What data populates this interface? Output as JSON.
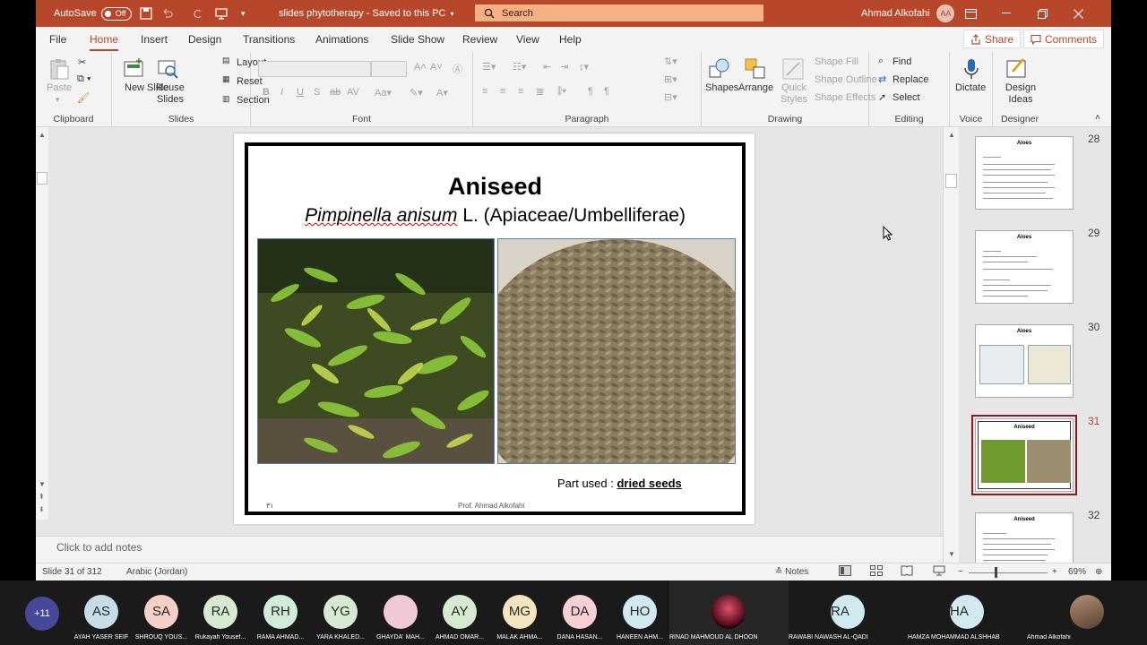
{
  "titlebar": {
    "autosave_label": "AutoSave",
    "autosave_state": "Off",
    "doc_title": "slides phytotherapy  -  Saved to this PC",
    "search_placeholder": "Search",
    "user_name": "Ahmad Alkofahi",
    "user_initials": "AA",
    "accent_color": "#b7472a"
  },
  "tabs": [
    "File",
    "Home",
    "Insert",
    "Design",
    "Transitions",
    "Animations",
    "Slide Show",
    "Review",
    "View",
    "Help"
  ],
  "active_tab": "Home",
  "share_label": "Share",
  "comments_label": "Comments",
  "ribbon": {
    "clipboard": {
      "label": "Clipboard",
      "paste": "Paste"
    },
    "slides": {
      "label": "Slides",
      "new_slide": "New Slide",
      "reuse_slides": "Reuse Slides",
      "layout": "Layout",
      "reset": "Reset",
      "section": "Section"
    },
    "font": {
      "label": "Font"
    },
    "paragraph": {
      "label": "Paragraph"
    },
    "drawing": {
      "label": "Drawing",
      "shapes": "Shapes",
      "arrange": "Arrange",
      "quick_styles": "Quick Styles",
      "shape_fill": "Shape Fill",
      "shape_outline": "Shape Outline",
      "shape_effects": "Shape Effects"
    },
    "editing": {
      "label": "Editing",
      "find": "Find",
      "replace": "Replace",
      "select": "Select"
    },
    "voice": {
      "label": "Voice",
      "dictate": "Dictate"
    },
    "designer": {
      "label": "Designer",
      "design_ideas": "Design Ideas"
    }
  },
  "slide": {
    "title": "Aniseed",
    "subtitle_italic": "Pimpinella anisum",
    "subtitle_rest": " L. (Apiaceae/Umbelliferae)",
    "part_used_label": "Part used : ",
    "part_used_value": "dried seeds",
    "footer": "Prof. Ahmad Alkofahi",
    "page_num": "٣١"
  },
  "thumbnails": [
    {
      "num": "28",
      "title": "Aloes"
    },
    {
      "num": "29",
      "title": "Aloes"
    },
    {
      "num": "30",
      "title": "Aloes"
    },
    {
      "num": "31",
      "title": "Aniseed",
      "selected": true
    },
    {
      "num": "32",
      "title": "Aniseed"
    }
  ],
  "notes_placeholder": "Click to add notes",
  "status": {
    "slide_info": "Slide 31 of 312",
    "language": "Arabic (Jordan)",
    "notes": "Notes",
    "zoom": "69%"
  },
  "participants": {
    "more": "+11",
    "list": [
      {
        "initials": "AS",
        "name": "AYAH YASER SEIF",
        "color": "#c6dde8"
      },
      {
        "initials": "SA",
        "name": "SHROUQ YOUS...",
        "color": "#f6d0c8"
      },
      {
        "initials": "RA",
        "name": "Rukayah Yousef...",
        "color": "#d6ead2"
      },
      {
        "initials": "RH",
        "name": "RAMA AHMAD...",
        "color": "#d1ecd8"
      },
      {
        "initials": "YG",
        "name": "YARA KHALED...",
        "color": "#d6ead2"
      },
      {
        "initials": "",
        "name": "GHAYDA' MAH...",
        "color": "#f0c8d6"
      },
      {
        "initials": "AY",
        "name": "AHMAD OMAR...",
        "color": "#d6ead2"
      },
      {
        "initials": "MG",
        "name": "MALAK AHMA...",
        "color": "#f4e4c0"
      },
      {
        "initials": "DA",
        "name": "DANA HASAN...",
        "color": "#f6d0d4"
      },
      {
        "initials": "HO",
        "name": "HANEEN AHM...",
        "color": "#d0eaf0"
      }
    ],
    "big": [
      {
        "initials": "",
        "name": "RINAD MAHMOUD AL DHOON"
      },
      {
        "initials": "RA",
        "name": "RAWABI NAWASH AL-QADI"
      },
      {
        "initials": "HA",
        "name": "HAMZA MOHAMMAD ALSHHAB"
      },
      {
        "initials": "",
        "name": "Ahmad Alkofahi"
      }
    ]
  }
}
